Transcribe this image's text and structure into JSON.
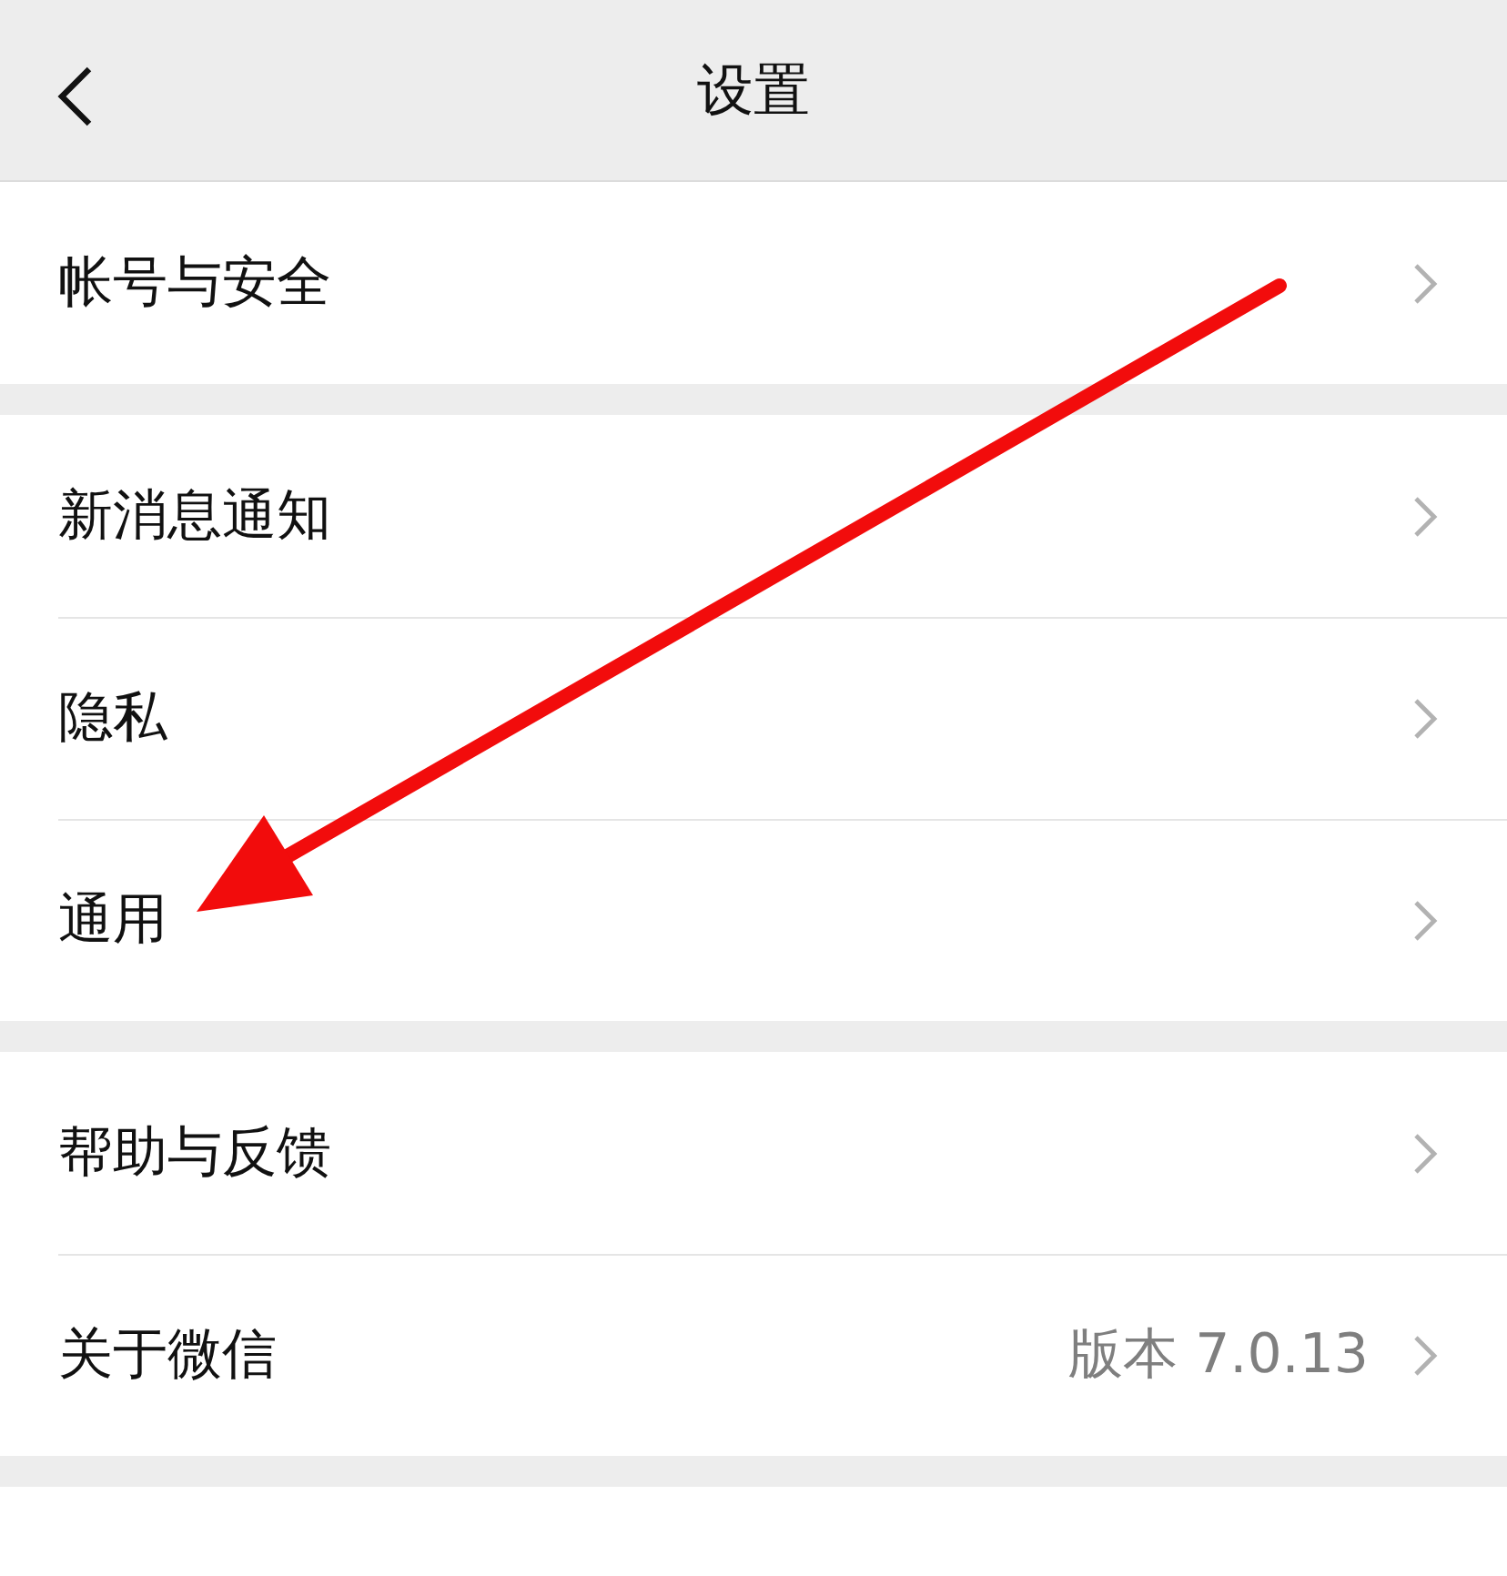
{
  "header": {
    "title": "设置"
  },
  "groups": [
    {
      "rows": [
        {
          "label": "帐号与安全"
        }
      ]
    },
    {
      "rows": [
        {
          "label": "新消息通知"
        },
        {
          "label": "隐私"
        },
        {
          "label": "通用"
        }
      ]
    },
    {
      "rows": [
        {
          "label": "帮助与反馈"
        },
        {
          "label": "关于微信",
          "value": "版本 7.0.13"
        }
      ]
    },
    {
      "rows": [
        {}
      ]
    }
  ]
}
